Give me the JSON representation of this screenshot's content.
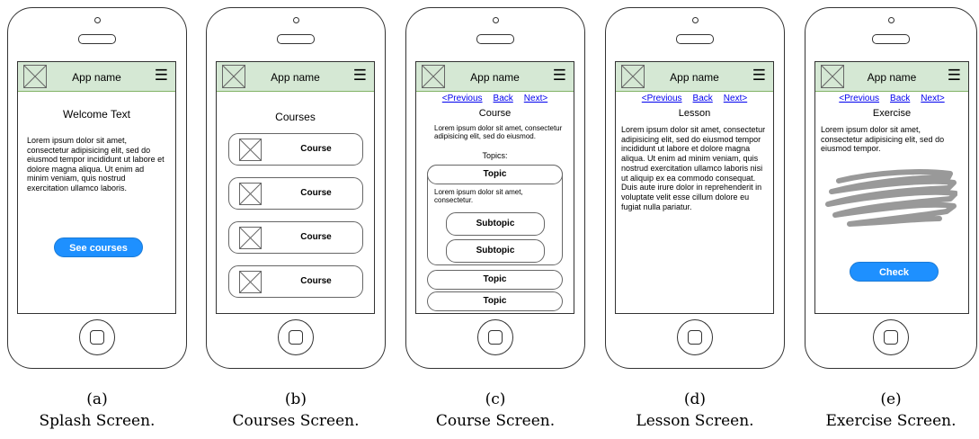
{
  "app_name": "App name",
  "menu_glyph": "☰",
  "nav": {
    "prev": "<Previous",
    "back": "Back",
    "next": "Next>"
  },
  "screen_a": {
    "title": "Welcome Text",
    "body": "Lorem ipsum dolor sit amet, consectetur adipisicing elit, sed do eiusmod tempor incididunt ut labore et dolore magna aliqua. Ut enim ad minim veniam, quis nostrud exercitation ullamco laboris.",
    "button": "See courses"
  },
  "screen_b": {
    "title": "Courses",
    "courses": [
      "Course",
      "Course",
      "Course",
      "Course"
    ]
  },
  "screen_c": {
    "title": "Course",
    "body": "Lorem ipsum dolor sit amet, consectetur adipisicing elit, sed do eiusmod.",
    "topics_label": "Topics:",
    "topic_expanded": "Topic",
    "topic_text": "Lorem ipsum dolor sit amet, consectetur.",
    "subtopics": [
      "Subtopic",
      "Subtopic"
    ],
    "topics_more": [
      "Topic",
      "Topic"
    ]
  },
  "screen_d": {
    "title": "Lesson",
    "body": "Lorem ipsum dolor sit amet, consectetur adipisicing elit, sed do eiusmod tempor incididunt ut labore et dolore magna aliqua. Ut enim ad minim veniam, quis nostrud exercitation ullamco laboris nisi ut aliquip ex ea commodo consequat. Duis aute irure dolor in reprehenderit in voluptate velit esse cillum dolore eu fugiat nulla pariatur."
  },
  "screen_e": {
    "title": "Exercise",
    "body": "Lorem ipsum dolor sit amet, consectetur adipisicing elit, sed do eiusmod tempor.",
    "button": "Check"
  },
  "captions": [
    {
      "letter": "(a)",
      "text": "Splash Screen."
    },
    {
      "letter": "(b)",
      "text": "Courses Screen."
    },
    {
      "letter": "(c)",
      "text": "Course Screen."
    },
    {
      "letter": "(d)",
      "text": "Lesson Screen."
    },
    {
      "letter": "(e)",
      "text": "Exercise Screen."
    }
  ],
  "colors": {
    "header": "#d5e8d4",
    "header_border": "#82b366",
    "button": "#1e90ff",
    "link": "#0000ee",
    "scribble": "#999999"
  }
}
